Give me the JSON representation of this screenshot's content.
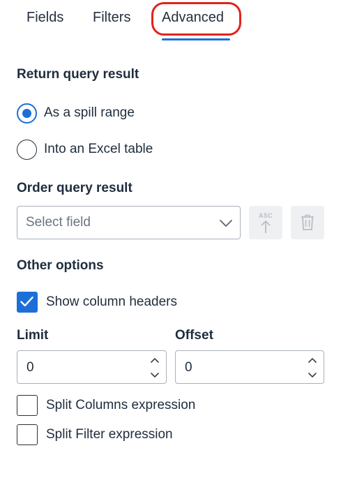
{
  "tabs": [
    {
      "label": "Fields"
    },
    {
      "label": "Filters"
    },
    {
      "label": "Advanced",
      "active": true
    }
  ],
  "return_section": {
    "title": "Return query result",
    "options": [
      {
        "label": "As a spill range",
        "selected": true
      },
      {
        "label": "Into an Excel table",
        "selected": false
      }
    ]
  },
  "order_section": {
    "title": "Order query result",
    "select_placeholder": "Select field",
    "sort_button_label": "ASC"
  },
  "other_section": {
    "title": "Other options",
    "show_headers": {
      "label": "Show column headers",
      "checked": true
    }
  },
  "limit": {
    "label": "Limit",
    "value": "0"
  },
  "offset": {
    "label": "Offset",
    "value": "0"
  },
  "split_options": [
    {
      "label": "Split Columns expression",
      "checked": false
    },
    {
      "label": "Split Filter expression",
      "checked": false
    }
  ],
  "colors": {
    "accent": "#1c6fd8",
    "highlight": "#e2231a",
    "text": "#1f2d3d",
    "disabled": "#b8bec6"
  },
  "icons": [
    "chevron-down-icon",
    "sort-ascending-icon",
    "trash-icon",
    "checkmark-icon",
    "stepper-up-icon",
    "stepper-down-icon"
  ]
}
